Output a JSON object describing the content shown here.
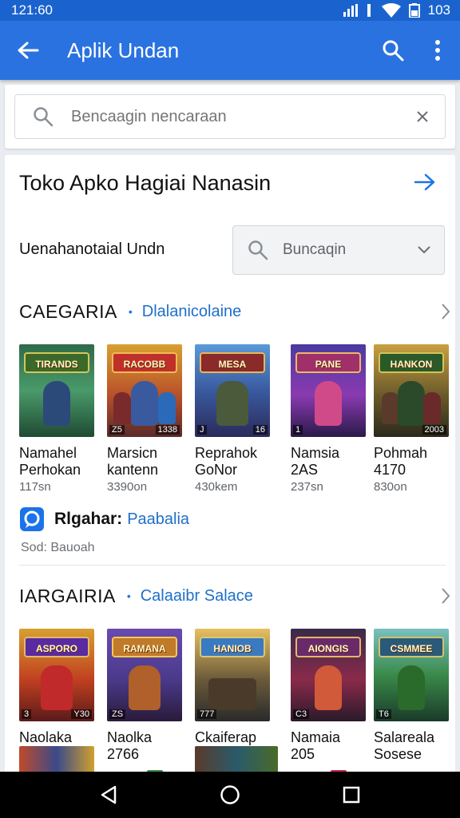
{
  "status_bar": {
    "time": "121:60",
    "battery_text": "103"
  },
  "app_bar": {
    "title": "Aplik Undan",
    "back_icon": "arrow-left-icon",
    "search_icon": "search-icon",
    "more_icon": "more-vert-icon"
  },
  "search": {
    "placeholder": "Bencaagin nencaraan",
    "clear_icon": "close-icon"
  },
  "store": {
    "title": "Toko Apko Hagiai Nanasin",
    "arrow_icon": "arrow-right-icon"
  },
  "filter": {
    "label": "Uenahanotaial Undn",
    "placeholder": "Buncaqin"
  },
  "sections": [
    {
      "name": "CAEGARIA",
      "subtitle": "Dlalanicolaine",
      "apps": [
        {
          "line1": "Namahel",
          "line2": "Perhokan",
          "meta": "117sn",
          "art": "TIRANDS",
          "tag_left": "",
          "tag_right": ""
        },
        {
          "line1": "Marsicn",
          "line2": "kantenn",
          "meta": "3390on",
          "art": "RACOBB",
          "tag_left": "Z5",
          "tag_right": "1338"
        },
        {
          "line1": "Reprahok",
          "line2": "GoNor",
          "meta": "430kem",
          "art": "MESA",
          "tag_left": "J",
          "tag_right": "16"
        },
        {
          "line1": "Namsia",
          "line2": "2AS",
          "meta": "237sn",
          "art": "PANE",
          "tag_left": "1",
          "tag_right": ""
        },
        {
          "line1": "Pohmah",
          "line2": "4170",
          "meta": "830on",
          "art": "HANKON",
          "tag_left": "",
          "tag_right": "2003"
        }
      ]
    },
    {
      "name": "IARGAIRIA",
      "subtitle": "Calaaibr Salace",
      "apps": [
        {
          "line1": "Naolaka",
          "line2": "",
          "meta": "",
          "art": "ASPORO",
          "tag_left": "3",
          "tag_right": "Y30"
        },
        {
          "line1": "Naolka",
          "line2": "2766",
          "meta": "",
          "art": "RAMANA",
          "tag_left": "ZS",
          "tag_right": ""
        },
        {
          "line1": "Ckaiferap",
          "line2": "",
          "meta": "",
          "art": "HANIOB",
          "tag_left": "777",
          "tag_right": ""
        },
        {
          "line1": "Namaia",
          "line2": "205",
          "meta": "",
          "art": "AIONGIS",
          "tag_left": "C3",
          "tag_right": ""
        },
        {
          "line1": "Salareala",
          "line2": "Sosese",
          "meta": "",
          "art": "CSMMEE",
          "tag_left": "T6",
          "tag_right": ""
        }
      ]
    }
  ],
  "promo": {
    "title": "Rlgahar:",
    "link": "Paabalia",
    "subtitle": "Sod: Bauoah",
    "icon": "chat-bubble-icon"
  },
  "nav": {
    "back": "triangle-back-icon",
    "home": "circle-home-icon",
    "recents": "square-recents-icon"
  },
  "colors": {
    "app_bar": "#2a72e0",
    "status_bar": "#1a63cf",
    "link": "#1f6fc9"
  }
}
